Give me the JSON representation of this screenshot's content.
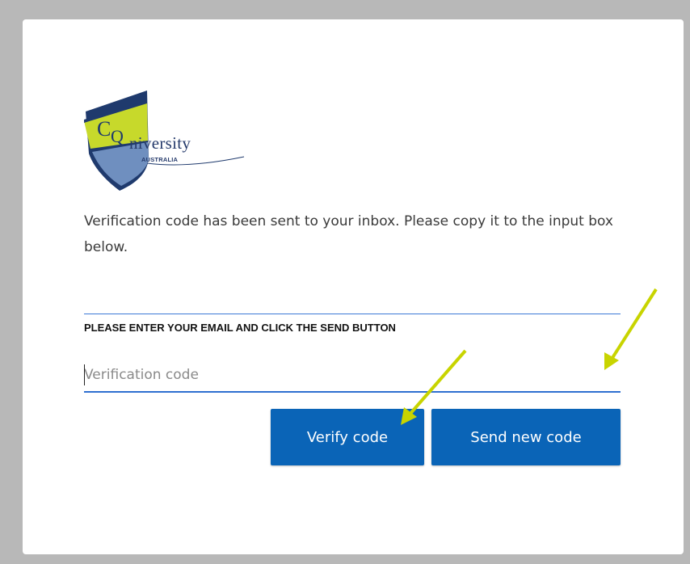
{
  "logo": {
    "name": "CQUniversity",
    "mark_letters": "CQ",
    "wordmark": "niversity",
    "subtitle": "AUSTRALIA",
    "colors": {
      "navy": "#1f3a6d",
      "lime": "#c7d92b",
      "steel": "#6f8fbf"
    }
  },
  "intro_text": "Verification code has been sent to your inbox. Please copy it to the input box below.",
  "form": {
    "label": "PLEASE ENTER YOUR EMAIL AND CLICK THE SEND BUTTON",
    "code_input": {
      "value": "",
      "placeholder": "Verification code"
    }
  },
  "buttons": {
    "verify_label": "Verify code",
    "send_new_label": "Send new code"
  },
  "annotations": {
    "arrow_color": "#c8d400",
    "arrows": [
      "arrow-to-verify-button",
      "arrow-to-send-new-code-area"
    ]
  },
  "colors": {
    "accent": "#0a64b7",
    "input_underline": "#2f6fd0",
    "backdrop": "#b8b8b8"
  }
}
